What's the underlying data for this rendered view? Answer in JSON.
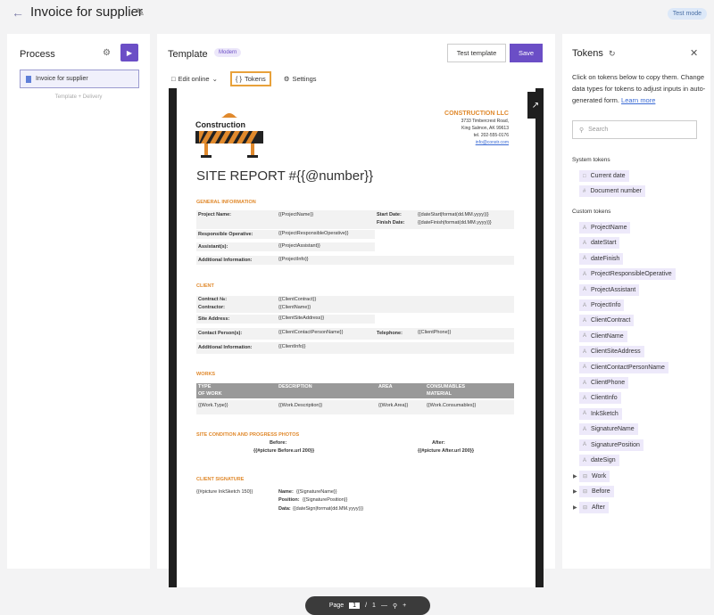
{
  "header": {
    "title": "Invoice for supplier",
    "test_mode": "Test mode"
  },
  "process": {
    "title": "Process",
    "item": "Invoice for supplier",
    "sub_left": "Template",
    "sub_right": "Delivery"
  },
  "template": {
    "title": "Template",
    "badge": "Modern",
    "test_btn": "Test template",
    "save_btn": "Save",
    "tabs": {
      "edit": "Edit online",
      "tokens": "Tokens",
      "settings": "Settings"
    }
  },
  "doc": {
    "company": {
      "name": "CONSTRUCTION LLC",
      "addr1": "3733 Timbercrest Road,",
      "addr2": "King Salmon, AK 99613",
      "tel": "tel. 202-555-0176",
      "email": "info@constr.com"
    },
    "logo_text": "Construction",
    "report_title": "SITE REPORT #{{@number}}",
    "general": {
      "heading": "GENERAL INFORMATION",
      "project_name_l": "Project Name:",
      "project_name_v": "{{ProjectName}}",
      "start_l": "Start Date:",
      "start_v": "{{dateStart|format(dd.MM.yyyy)}}",
      "finish_l": "Finish Date:",
      "finish_v": "{{dateFinish|format(dd.MM.yyyy)}}",
      "resp_l": "Responsible Operative:",
      "resp_v": "{{ProjectResponsibleOperative}}",
      "asst_l": "Assistant(s):",
      "asst_v": "{{ProjectAssistant}}",
      "info_l": "Additional Information:",
      "info_v": "{{ProjectInfo}}"
    },
    "client": {
      "heading": "CLIENT",
      "contract_l": "Contract №:",
      "contract_v": "{{ClientContract}}",
      "contractor_l": "Contractor:",
      "contractor_v": "{{ClientName}}",
      "site_l": "Site Address:",
      "site_v": "{{ClientSiteAddress}}",
      "contact_l": "Contact Person(s):",
      "contact_v": "{{ClientContactPersonName}}",
      "tel_l": "Telephone:",
      "tel_v": "{{ClientPhone}}",
      "info_l": "Additional Information:",
      "info_v": "{{ClientInfo}}"
    },
    "works": {
      "heading": "WORKS",
      "cols": [
        "TYPE",
        "OF WORK",
        "DESCRIPTION",
        "AREA",
        "CONSUMABLES",
        "MATERIAL"
      ],
      "cells": [
        "{{Work.Type}}",
        "{{Work.Description}}",
        "{{Work.Area}}",
        "{{Work.Consumables}}"
      ]
    },
    "photos": {
      "heading": "SITE CONDITION AND PROGRESS PHOTOS",
      "before_l": "Before:",
      "after_l": "After:",
      "before_v": "{{#picture Before.url 200}}",
      "after_v": "{{#picture After.url 200}}"
    },
    "signature": {
      "heading": "CLIENT SIGNATURE",
      "ink": "{{#picture InkSketch 150}}",
      "name_l": "Name:",
      "name_v": "{{SignatureName}}",
      "pos_l": "Position:",
      "pos_v": "{{SignaturePosition}}",
      "date_l": "Data:",
      "date_v": "{{dateSign|format(dd.MM.yyyy)}}"
    }
  },
  "pager": {
    "label": "Page",
    "current": "1",
    "sep": "/",
    "total": "1"
  },
  "tokens": {
    "title": "Tokens",
    "desc": "Click on tokens below to copy them. Change data types for tokens to adjust inputs in auto-generated form.",
    "learn": "Learn more",
    "search_placeholder": "Search",
    "system_heading": "System tokens",
    "system": [
      "Current date",
      "Document number"
    ],
    "custom_heading": "Custom tokens",
    "custom": [
      "ProjectName",
      "dateStart",
      "dateFinish",
      "ProjectResponsibleOperative",
      "ProjectAssistant",
      "ProjectInfo",
      "ClientContract",
      "ClientName",
      "ClientSiteAddress",
      "ClientContactPersonName",
      "ClientPhone",
      "ClientInfo",
      "InkSketch",
      "SignatureName",
      "SignaturePosition",
      "dateSign"
    ],
    "collections": [
      "Work",
      "Before",
      "After"
    ]
  }
}
